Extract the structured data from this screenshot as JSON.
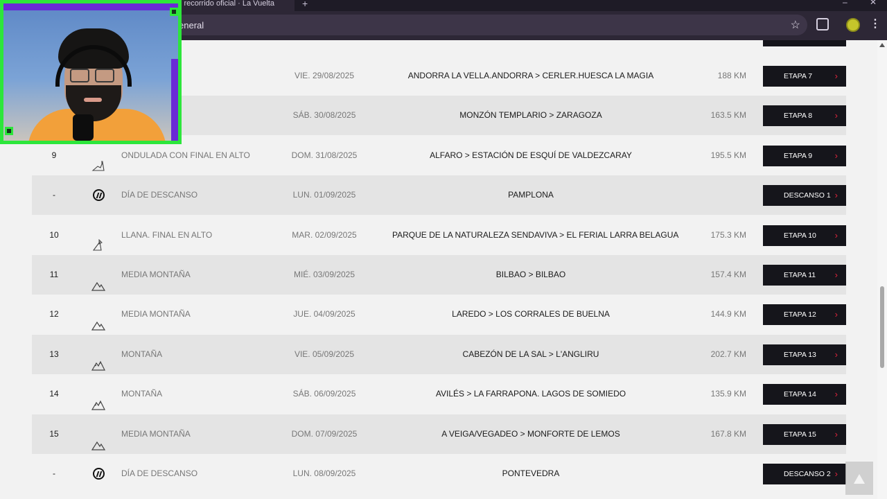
{
  "browser": {
    "tab_title": "l recorrido oficial · La Vuelta",
    "url_fragment": "eneral"
  },
  "rows": [
    {
      "num": "",
      "type": "",
      "date": "VIE. 29/08/2025",
      "route": "ANDORRA LA VELLA.ANDORRA > CERLER.HUESCA LA MAGIA",
      "km": "188 KM",
      "btn": "ETAPA 7",
      "icon": "mountain-icon",
      "alt": false
    },
    {
      "num": "",
      "type": "",
      "date": "SÁB. 30/08/2025",
      "route": "MONZÓN TEMPLARIO > ZARAGOZA",
      "km": "163.5 KM",
      "btn": "ETAPA 8",
      "icon": "mountain-icon",
      "alt": true
    },
    {
      "num": "9",
      "type": "ONDULADA CON FINAL EN ALTO",
      "date": "DOM. 31/08/2025",
      "route": "ALFARO > ESTACIÓN DE ESQUÍ DE VALDEZCARAY",
      "km": "195.5 KM",
      "btn": "ETAPA 9",
      "icon": "hilly-finish-icon",
      "alt": false
    },
    {
      "num": "-",
      "type": "DÍA DE DESCANSO",
      "date": "LUN. 01/09/2025",
      "route": "PAMPLONA",
      "km": "",
      "btn": "DESCANSO 1",
      "icon": "rest-day-icon",
      "alt": true
    },
    {
      "num": "10",
      "type": "LLANA. FINAL EN ALTO",
      "date": "MAR. 02/09/2025",
      "route": "PARQUE DE LA NATURALEZA SENDAVIVA > EL FERIAL LARRA BELAGUA",
      "km": "175.3 KM",
      "btn": "ETAPA 10",
      "icon": "flat-finish-icon",
      "alt": false
    },
    {
      "num": "11",
      "type": "MEDIA MONTAÑA",
      "date": "MIÉ. 03/09/2025",
      "route": "BILBAO > BILBAO",
      "km": "157.4 KM",
      "btn": "ETAPA 11",
      "icon": "medium-mountain-icon",
      "alt": true
    },
    {
      "num": "12",
      "type": "MEDIA MONTAÑA",
      "date": "JUE. 04/09/2025",
      "route": "LAREDO > LOS CORRALES DE BUELNA",
      "km": "144.9 KM",
      "btn": "ETAPA 12",
      "icon": "medium-mountain-icon",
      "alt": false
    },
    {
      "num": "13",
      "type": "MONTAÑA",
      "date": "VIE. 05/09/2025",
      "route": "CABEZÓN DE LA SAL > L'ANGLIRU",
      "km": "202.7 KM",
      "btn": "ETAPA 13",
      "icon": "mountain-icon",
      "alt": true
    },
    {
      "num": "14",
      "type": "MONTAÑA",
      "date": "SÁB. 06/09/2025",
      "route": "AVILÉS > LA FARRAPONA. LAGOS DE SOMIEDO",
      "km": "135.9 KM",
      "btn": "ETAPA 14",
      "icon": "mountain-icon",
      "alt": false
    },
    {
      "num": "15",
      "type": "MEDIA MONTAÑA",
      "date": "DOM. 07/09/2025",
      "route": "A VEIGA/VEGADEO > MONFORTE DE LEMOS",
      "km": "167.8 KM",
      "btn": "ETAPA 15",
      "icon": "medium-mountain-icon",
      "alt": true
    },
    {
      "num": "-",
      "type": "DÍA DE DESCANSO",
      "date": "LUN. 08/09/2025",
      "route": "PONTEVEDRA",
      "km": "",
      "btn": "DESCANSO 2",
      "icon": "rest-day-icon",
      "alt": false
    }
  ],
  "colors": {
    "accent": "#e0243d",
    "button_bg": "#15151b",
    "webcam_border": "#2de63b",
    "webcam_purple": "#6a2ad6"
  }
}
